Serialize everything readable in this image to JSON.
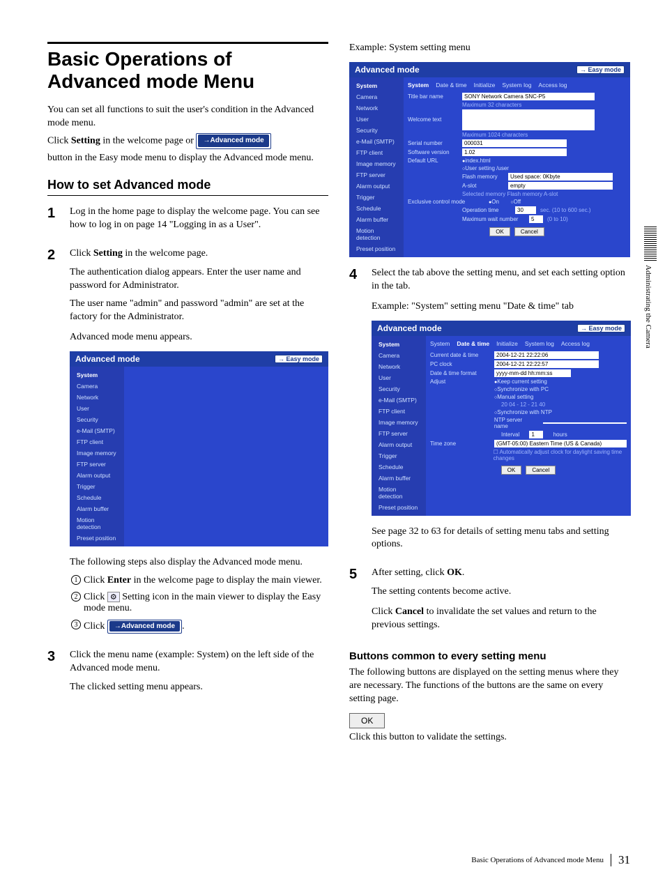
{
  "title": "Basic Operations of Advanced mode Menu",
  "intro": {
    "p1": "You can set all functions to suit the user's condition in the Advanced mode menu.",
    "p2a": "Click ",
    "p2bold": "Setting",
    "p2b": " in the welcome page or ",
    "btn": "→Advanced mode",
    "p2c": "button in the Easy mode menu to display the Advanced mode menu."
  },
  "h2": "How to set Advanced mode",
  "steps": {
    "s1": "Log in the home page to display the welcome page. You can see how to log in on page 14 \"Logging in as a User\".",
    "s2a": "Click ",
    "s2bold": "Setting",
    "s2b": " in the welcome page.",
    "s2c": "The authentication dialog appears. Enter the user name and password for Administrator.",
    "s2d": "The user name \"admin\" and password \"admin\" are set at the factory for the Administrator.",
    "s2e": "Advanced mode menu appears.",
    "s3a": "Click the menu name (example: System) on the left side of the Advanced mode menu.",
    "s3b": "The clicked setting menu appears.",
    "s4a": "Select the tab above the setting menu, and set each setting option in the tab.",
    "s4b": "Example: \"System\" setting menu \"Date & time\" tab",
    "s4c": "See page 32 to 63 for details of setting menu tabs and setting options.",
    "s5a": "After setting, click ",
    "s5bold": "OK",
    "s5b": ".",
    "s5c": "The setting contents become active.",
    "s5d": "Click ",
    "s5bold2": "Cancel",
    "s5e": " to invalidate the set values and return to the previous settings."
  },
  "alt": {
    "lead": "The following steps also display the Advanced mode menu.",
    "a1a": "Click ",
    "a1bold": "Enter",
    "a1b": " in the welcome page to display the main viewer.",
    "a2a": "Click ",
    "a2b": " Setting icon in the main viewer to display the Easy mode menu.",
    "a3a": "Click ",
    "a3b": "."
  },
  "rightTop": "Example: System setting menu",
  "shot": {
    "title": "Advanced mode",
    "easy": "→ Easy mode",
    "side": [
      "System",
      "Camera",
      "Network",
      "User",
      "Security",
      "e-Mail (SMTP)",
      "FTP client",
      "Image memory",
      "FTP server",
      "Alarm output",
      "Trigger",
      "Schedule",
      "Alarm buffer",
      "Motion detection",
      "Preset position"
    ],
    "tabs": [
      "System",
      "Date & time",
      "Initialize",
      "System log",
      "Access log"
    ],
    "sys": {
      "titlebar_lbl": "Title bar name",
      "titlebar_val": "SONY Network Camera SNC-P5",
      "titlebar_note": "Maximum 32 characters",
      "welcome_lbl": "Welcome text",
      "welcome_note": "Maximum 1024 characters",
      "serial_lbl": "Serial number",
      "serial_val": "000031",
      "sw_lbl": "Software version",
      "sw_val": "1.02",
      "url_lbl": "Default URL",
      "url_r1": "index.html",
      "url_r2": "User setting  /user",
      "flash_lbl": "Flash memory",
      "flash_val": "Used space: 0Kbyte",
      "aslot_lbl": "A-slot",
      "aslot_val": "empty",
      "selmem": "Selected memory   Flash memory   A-slot",
      "excl_lbl": "Exclusive control mode",
      "excl_on": "On",
      "excl_off": "Off",
      "optime_lbl": "Operation time",
      "optime_val": "30",
      "optime_note": "sec. (10 to 600 sec.)",
      "maxwait_lbl": "Maximum wait number",
      "maxwait_val": "5",
      "maxwait_note": "(0 to 10)",
      "ok": "OK",
      "cancel": "Cancel"
    },
    "dt": {
      "cur_lbl": "Current date & time",
      "cur_val": "2004-12-21  22:22:06",
      "pc_lbl": "PC clock",
      "pc_val": "2004-12-21  22:22:57",
      "fmt_lbl": "Date & time format",
      "fmt_val": "yyyy-mm-dd hh:mm:ss",
      "adj_lbl": "Adjust",
      "adj_r1": "Keep current setting",
      "adj_r2": "Synchronize with PC",
      "adj_r3": "Manual setting",
      "man_vals": "20 04 - 12 - 21  40 ",
      "adj_r4": "Synchronize with NTP",
      "ntp_lbl": "NTP server name",
      "int_lbl": "Interval",
      "int_val": "1",
      "int_unit": "hours",
      "tz_lbl": "Time zone",
      "tz_val": "(GMT-05:00) Eastern Time (US & Canada)",
      "dst": "Automatically adjust clock for daylight saving time changes"
    }
  },
  "buttons_h": "Buttons common to every setting menu",
  "buttons_p": "The following buttons are displayed on the setting menus where they are necessary. The functions of the buttons are the same on every setting page.",
  "ok_label": "OK",
  "ok_desc": "Click this button to validate the settings.",
  "sideText": "Administrating the Camera",
  "footer": {
    "text": "Basic Operations of Advanced mode Menu",
    "page": "31"
  }
}
